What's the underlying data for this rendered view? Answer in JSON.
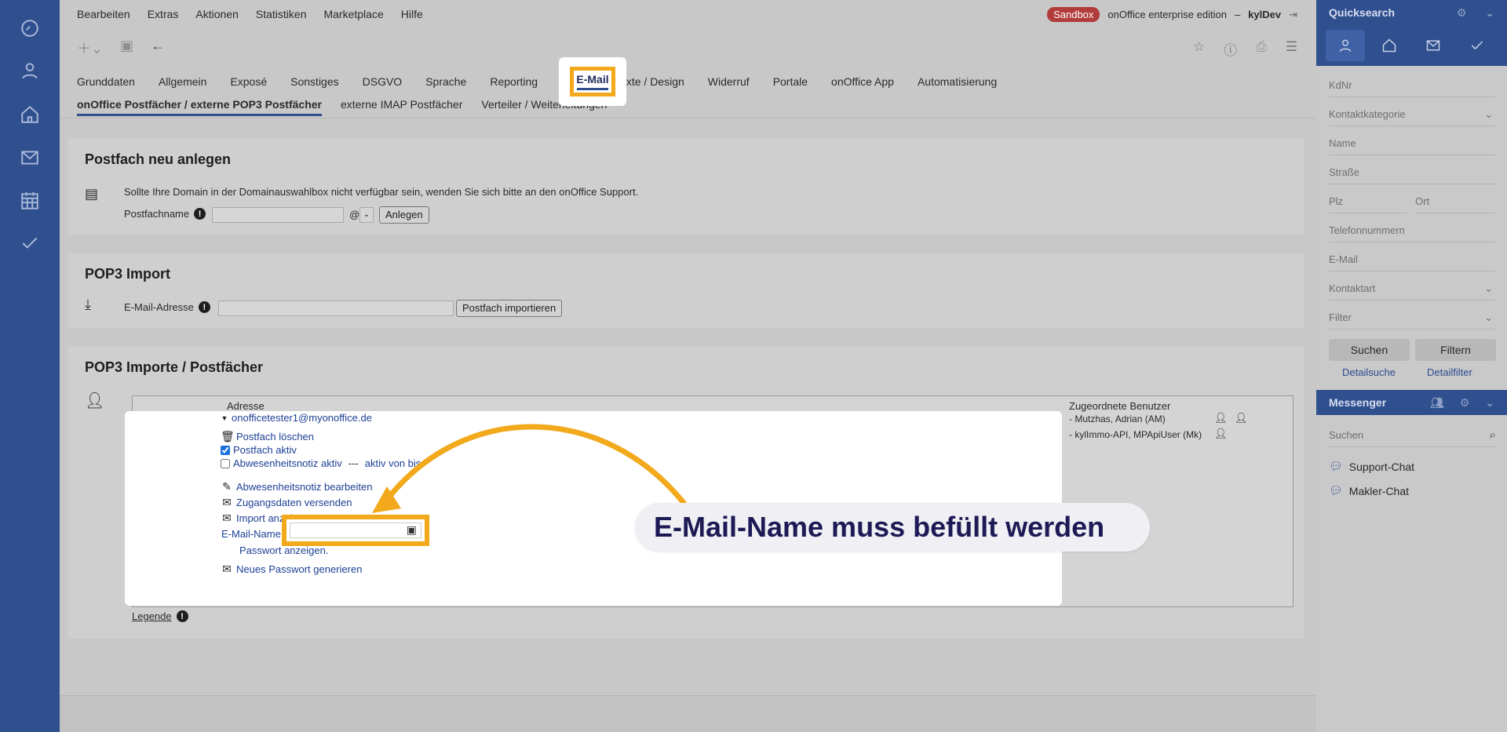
{
  "menu": [
    "Bearbeiten",
    "Extras",
    "Aktionen",
    "Statistiken",
    "Marketplace",
    "Hilfe"
  ],
  "header": {
    "sandbox": "Sandbox",
    "edition": "onOffice enterprise edition",
    "dash": "–",
    "user": "kylDev"
  },
  "tabs": [
    "Grunddaten",
    "Allgemein",
    "Exposé",
    "Sonstiges",
    "DSGVO",
    "Sprache",
    "Reporting",
    "E-Mail",
    "Texte / Design",
    "Widerruf",
    "Portale",
    "onOffice App",
    "Automatisierung"
  ],
  "active_tab": "E-Mail",
  "subtabs": [
    "onOffice Postfächer / externe POP3 Postfächer",
    "externe IMAP Postfächer",
    "Verteiler / Weiterleitungen"
  ],
  "card1": {
    "title": "Postfach neu anlegen",
    "hint": "Sollte Ihre Domain in der Domainauswahlbox nicht verfügbar sein, wenden Sie sich bitte an den onOffice Support.",
    "name_label": "Postfachname",
    "at": "@",
    "button": "Anlegen"
  },
  "card2": {
    "title": "POP3 Import",
    "email_label": "E-Mail-Adresse",
    "button": "Postfach importieren"
  },
  "card3": {
    "title": "POP3 Importe / Postfächer",
    "col_address": "Adresse",
    "col_users": "Zugeordnete Benutzer",
    "users_1": "- Mutzhas, Adrian (AM)",
    "users_2": "- kylImmo-API, MPApiUser (Mk)",
    "legend": "Legende"
  },
  "popup": {
    "mailbox": "onofficetester1@myonoffice.de",
    "delete": "Postfach löschen",
    "active": "Postfach aktiv",
    "absence": "Abwesenheitsnotiz aktiv",
    "sep": "---",
    "active_until": "aktiv von bis",
    "edit_absence": "Abwesenheitsnotiz bearbeiten",
    "send_credentials": "Zugangsdaten versenden",
    "import_show": "Import anzeigen",
    "email_name_label": "E-Mail-Name:",
    "show_password": "Passwort anzeigen.",
    "new_password": "Neues Passwort generieren",
    "callout": "E-Mail-Name muss befüllt werden"
  },
  "quicksearch": {
    "title": "Quicksearch",
    "fields": [
      "KdNr",
      "Kontaktkategorie",
      "Name",
      "Straße",
      "Plz",
      "Ort",
      "Telefonnummern",
      "E-Mail",
      "Kontaktart",
      "Filter"
    ],
    "search_btn": "Suchen",
    "filter_btn": "Filtern",
    "detail_search": "Detailsuche",
    "detail_filter": "Detailfilter"
  },
  "messenger": {
    "title": "Messenger",
    "search_placeholder": "Suchen",
    "chats": [
      "Support-Chat",
      "Makler-Chat"
    ]
  },
  "colors": {
    "accent": "#f2a91b",
    "nav": "#2f4f8e",
    "link": "#1d3f96",
    "sandbox": "#b23b3b"
  }
}
